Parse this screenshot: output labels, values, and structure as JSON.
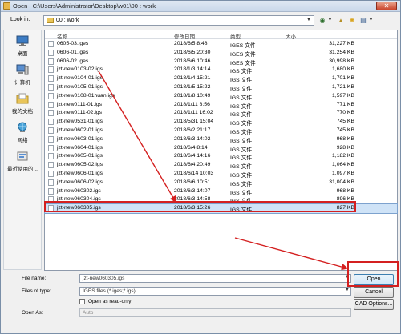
{
  "window": {
    "title": "Open : C:\\Users\\Administrator\\Desktop\\w01\\00 : work"
  },
  "lookin": {
    "label": "Look in:",
    "value": "00 : work"
  },
  "places": [
    {
      "label": "桌面",
      "icon": "desktop-icon"
    },
    {
      "label": "计算机",
      "icon": "computer-icon"
    },
    {
      "label": "我的文档",
      "icon": "documents-icon"
    },
    {
      "label": "网络",
      "icon": "network-icon"
    },
    {
      "label": "最近使用的...",
      "icon": "recent-icon"
    }
  ],
  "columns": {
    "name": "名称",
    "date": "修改日期",
    "type": "类型",
    "size": "大小"
  },
  "files": [
    {
      "name": "0605-03.iges",
      "date": "2018/6/5 8:48",
      "type": "IGES 文件",
      "size": "31,227 KB"
    },
    {
      "name": "0606-01.iges",
      "date": "2018/6/5 20:30",
      "type": "IGES 文件",
      "size": "31,254 KB"
    },
    {
      "name": "0606-02.iges",
      "date": "2018/6/6 10:46",
      "type": "IGES 文件",
      "size": "30,998 KB"
    },
    {
      "name": "jzt-new0103-02.igs",
      "date": "2018/1/3 14:14",
      "type": "IGS 文件",
      "size": "1,680 KB"
    },
    {
      "name": "jzt-new0104-01.igs",
      "date": "2018/1/4 15:21",
      "type": "IGS 文件",
      "size": "1,701 KB"
    },
    {
      "name": "jzt-new0105-01.igs",
      "date": "2018/1/5 15:22",
      "type": "IGS 文件",
      "size": "1,721 KB"
    },
    {
      "name": "jzt-new0108-01huan.igs",
      "date": "2018/1/8 10:49",
      "type": "IGS 文件",
      "size": "1,597 KB"
    },
    {
      "name": "jzt-new0111-01.igs",
      "date": "2018/1/11 8:56",
      "type": "IGS 文件",
      "size": "771 KB"
    },
    {
      "name": "jzt-new0111-02.igs",
      "date": "2018/1/11 16:02",
      "type": "IGS 文件",
      "size": "770 KB"
    },
    {
      "name": "jzt-new0531-01.igs",
      "date": "2018/5/31 15:04",
      "type": "IGS 文件",
      "size": "745 KB"
    },
    {
      "name": "jzt-new0602-01.igs",
      "date": "2018/6/2 21:17",
      "type": "IGS 文件",
      "size": "745 KB"
    },
    {
      "name": "jzt-new0603-01.igs",
      "date": "2018/6/3 14:02",
      "type": "IGS 文件",
      "size": "968 KB"
    },
    {
      "name": "jzt-new0604-01.igs",
      "date": "2018/6/4 8:14",
      "type": "IGS 文件",
      "size": "928 KB"
    },
    {
      "name": "jzt-new0605-01.igs",
      "date": "2018/6/4 14:16",
      "type": "IGS 文件",
      "size": "1,182 KB"
    },
    {
      "name": "jzt-new0605-02.igs",
      "date": "2018/6/4 20:49",
      "type": "IGS 文件",
      "size": "1,064 KB"
    },
    {
      "name": "jzt-new0606-01.igs",
      "date": "2018/6/14 10:03",
      "type": "IGS 文件",
      "size": "1,097 KB"
    },
    {
      "name": "jzt-new0606-02.igs",
      "date": "2018/6/6 10:51",
      "type": "IGS 文件",
      "size": "31,004 KB"
    },
    {
      "name": "jzt-new060302.igs",
      "date": "2018/6/3 14:07",
      "type": "IGS 文件",
      "size": "968 KB"
    },
    {
      "name": "jzt-new060304.igs",
      "date": "2018/6/3 14:58",
      "type": "IGS 文件",
      "size": "896 KB"
    },
    {
      "name": "jzt-new060305.igs",
      "date": "2018/6/3 15:26",
      "type": "IGS 文件",
      "size": "827 KB",
      "selected": true
    }
  ],
  "bottom": {
    "filename_label": "File name:",
    "filename_value": "jzt-new060305.igs",
    "filetype_label": "Files of type:",
    "filetype_value": "IGES files (*.iges;*.igs)",
    "readonly_label": "Open as read-only",
    "openas_label": "Open As:",
    "openas_value": "Auto",
    "open_button": "Open",
    "cancel_button": "Cancel",
    "cad_options_button": "CAD Options..."
  },
  "colors": {
    "annotation": "#d42020",
    "selection": "#cfe3f7"
  }
}
